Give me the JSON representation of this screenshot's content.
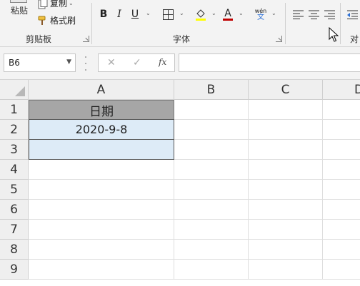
{
  "ribbon": {
    "clipboard": {
      "paste_label": "粘贴",
      "copy_label": "复制",
      "format_painter_label": "格式刷",
      "group_label": "剪贴板"
    },
    "font": {
      "bold_label": "B",
      "italic_label": "I",
      "underline_label": "U",
      "font_color_label": "A",
      "phonetic_top": "wén",
      "phonetic_bottom": "文",
      "group_label": "字体"
    },
    "alignment": {
      "group_label_partial": "对"
    }
  },
  "formula_bar": {
    "name_box_value": "B6",
    "cancel_symbol": "✕",
    "enter_symbol": "✓",
    "fx_label": "fx",
    "formula_value": ""
  },
  "sheet": {
    "columns": [
      "A",
      "B",
      "C",
      "D"
    ],
    "rows": [
      "1",
      "2",
      "3",
      "4",
      "5",
      "6",
      "7",
      "8",
      "9"
    ],
    "cells": {
      "A1": "日期",
      "A2": "2020-9-8",
      "A3": ""
    }
  },
  "colors": {
    "header_fill": "#a6a6a6",
    "table_fill": "#ddebf7",
    "font_color_bar": "#c00000",
    "fill_color_bar": "#ffff00"
  }
}
